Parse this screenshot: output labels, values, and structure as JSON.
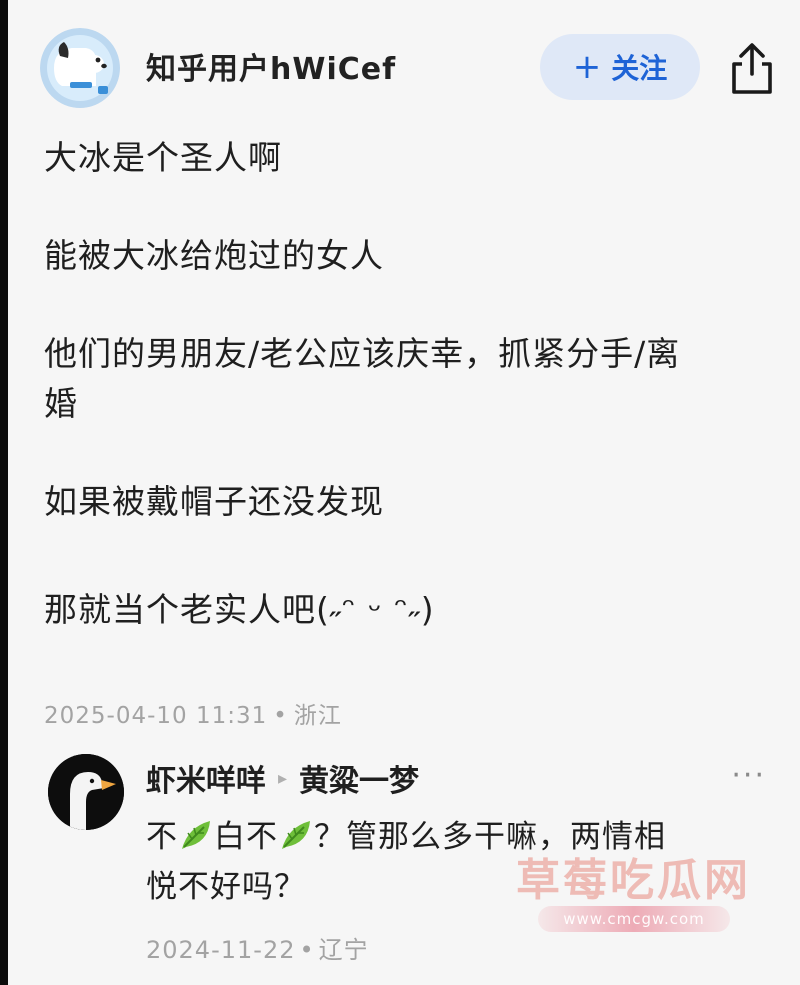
{
  "header": {
    "username": "知乎用户hWiCef",
    "follow_plus": "+",
    "follow_label": "关注"
  },
  "post": {
    "lines": [
      "大冰是个圣人啊",
      "能被大冰给炮过的女人",
      "他们的男朋友/老公应该庆幸，抓紧分手/离",
      "婚",
      "如果被戴帽子还没发现",
      "那就当个老实人吧(˶ᵔ ᵕ ᵔ˶)"
    ],
    "date": "2025-04-10 11:31",
    "location": "浙江",
    "separator": "•"
  },
  "reply": {
    "author": "虾米咩咩",
    "arrow": "▸",
    "reply_to": "黄粱一梦",
    "more": "···",
    "text_line1_a": "不",
    "text_line1_b": "白不",
    "text_line1_c": "？管那么多干嘛，两情相",
    "text_line2": "悦不好吗？",
    "date": "2024-11-22",
    "location": "辽宁",
    "separator": "•"
  },
  "watermark": {
    "title": "草莓吃瓜网",
    "url": "www.cmcgw.com"
  },
  "icons": {
    "share": "share-icon",
    "leaf": "leaf-emoji-icon",
    "avatar_user": "dog-avatar-icon",
    "avatar_reply": "goose-avatar-icon"
  },
  "colors": {
    "accent": "#1e63d6",
    "follow_bg": "#dfe8f7",
    "meta_text": "#a3a3a3",
    "background": "#f6f6f6"
  }
}
